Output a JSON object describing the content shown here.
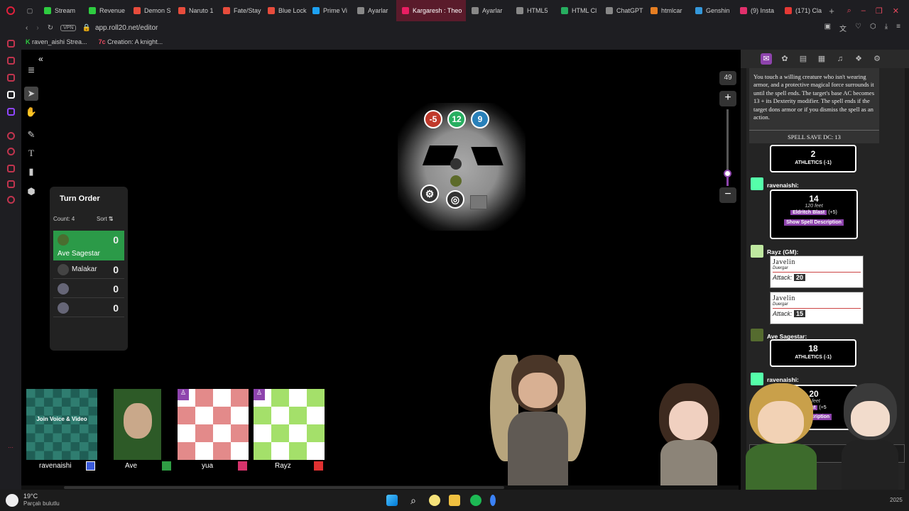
{
  "browser": {
    "tabs": [
      {
        "label": "Stream",
        "color": "#2ecc40"
      },
      {
        "label": "Revenue",
        "color": "#2ecc40"
      },
      {
        "label": "Demon S",
        "color": "#e74c3c"
      },
      {
        "label": "Naruto 1",
        "color": "#e74c3c"
      },
      {
        "label": "Fate/Stay",
        "color": "#e74c3c"
      },
      {
        "label": "Blue Lock",
        "color": "#e74c3c"
      },
      {
        "label": "Prime Vi",
        "color": "#1da1f2"
      },
      {
        "label": "Ayarlar",
        "color": "#888"
      },
      {
        "label": "Kargaresh : Theo",
        "color": "#e91e63"
      },
      {
        "label": "Ayarlar",
        "color": "#888"
      },
      {
        "label": "HTML5",
        "color": "#888"
      },
      {
        "label": "HTML Cl",
        "color": "#27ae60"
      },
      {
        "label": "ChatGPT",
        "color": "#888"
      },
      {
        "label": "htmlcar",
        "color": "#e67e22"
      },
      {
        "label": "Genshin",
        "color": "#3498db"
      },
      {
        "label": "(9) Insta",
        "color": "#e1306c"
      },
      {
        "label": "(171) Cla",
        "color": "#e53935"
      }
    ],
    "vpn": "VPN",
    "url": "app.roll20.net/editor",
    "bookmarks": [
      "raven_aishi Strea...",
      "Creation: A knight..."
    ]
  },
  "turn_order": {
    "title": "Turn Order",
    "count": "Count: 4",
    "sort": "Sort",
    "rows": [
      {
        "name": "Ave Sagestar",
        "value": "0"
      },
      {
        "name": "Malakar",
        "value": "0"
      },
      {
        "name": "",
        "value": "0"
      },
      {
        "name": "",
        "value": "0"
      }
    ]
  },
  "map": {
    "badges": [
      "-5",
      "12",
      "9"
    ]
  },
  "zoom": {
    "level": "49"
  },
  "chat": {
    "spell_text": "You touch a willing creature who isn't wearing armor, and a protective magical force surrounds it until the spell ends. The target's base AC becomes 13 + its Dexterity modifier. The spell ends if the target dons armor or if you dismiss the spell as an action.",
    "spell_save": "SPELL SAVE DC: 13",
    "roll1": {
      "value": "2",
      "label": "ATHLETICS (-1)"
    },
    "user1": "ravenaishi:",
    "roll2": {
      "value": "14",
      "range": "120 feet",
      "spell": "Eldritch Blast",
      "bonus": "(+5)",
      "button": "Show Spell Description"
    },
    "user2": "Rayz (GM):",
    "attack1": {
      "name": "Javelin",
      "source": "Duergar",
      "label": "Attack:",
      "value": "20"
    },
    "attack2": {
      "name": "Javelin",
      "source": "Duergar",
      "label": "Attack:",
      "value": "15"
    },
    "user3": "Ave Sagestar:",
    "roll3": {
      "value": "18",
      "label": "ATHLETICS (-1)"
    },
    "user4": "ravenaishi:",
    "roll4": {
      "value": "20",
      "range": "0 feet",
      "spell": "Blast",
      "bonus": "(+5",
      "button": "ll Description"
    }
  },
  "players": [
    {
      "name": "ravenaishi",
      "overlay": "Join Voice & Video",
      "color": "#3b5bdb"
    },
    {
      "name": "Ave",
      "color": "#2f9e44"
    },
    {
      "name": "yua",
      "color": "#d6336c"
    },
    {
      "name": "Rayz",
      "color": "#e03131"
    }
  ],
  "taskbar": {
    "temp": "19°C",
    "weather": "Parçalı bulutlu",
    "year": "2025"
  }
}
